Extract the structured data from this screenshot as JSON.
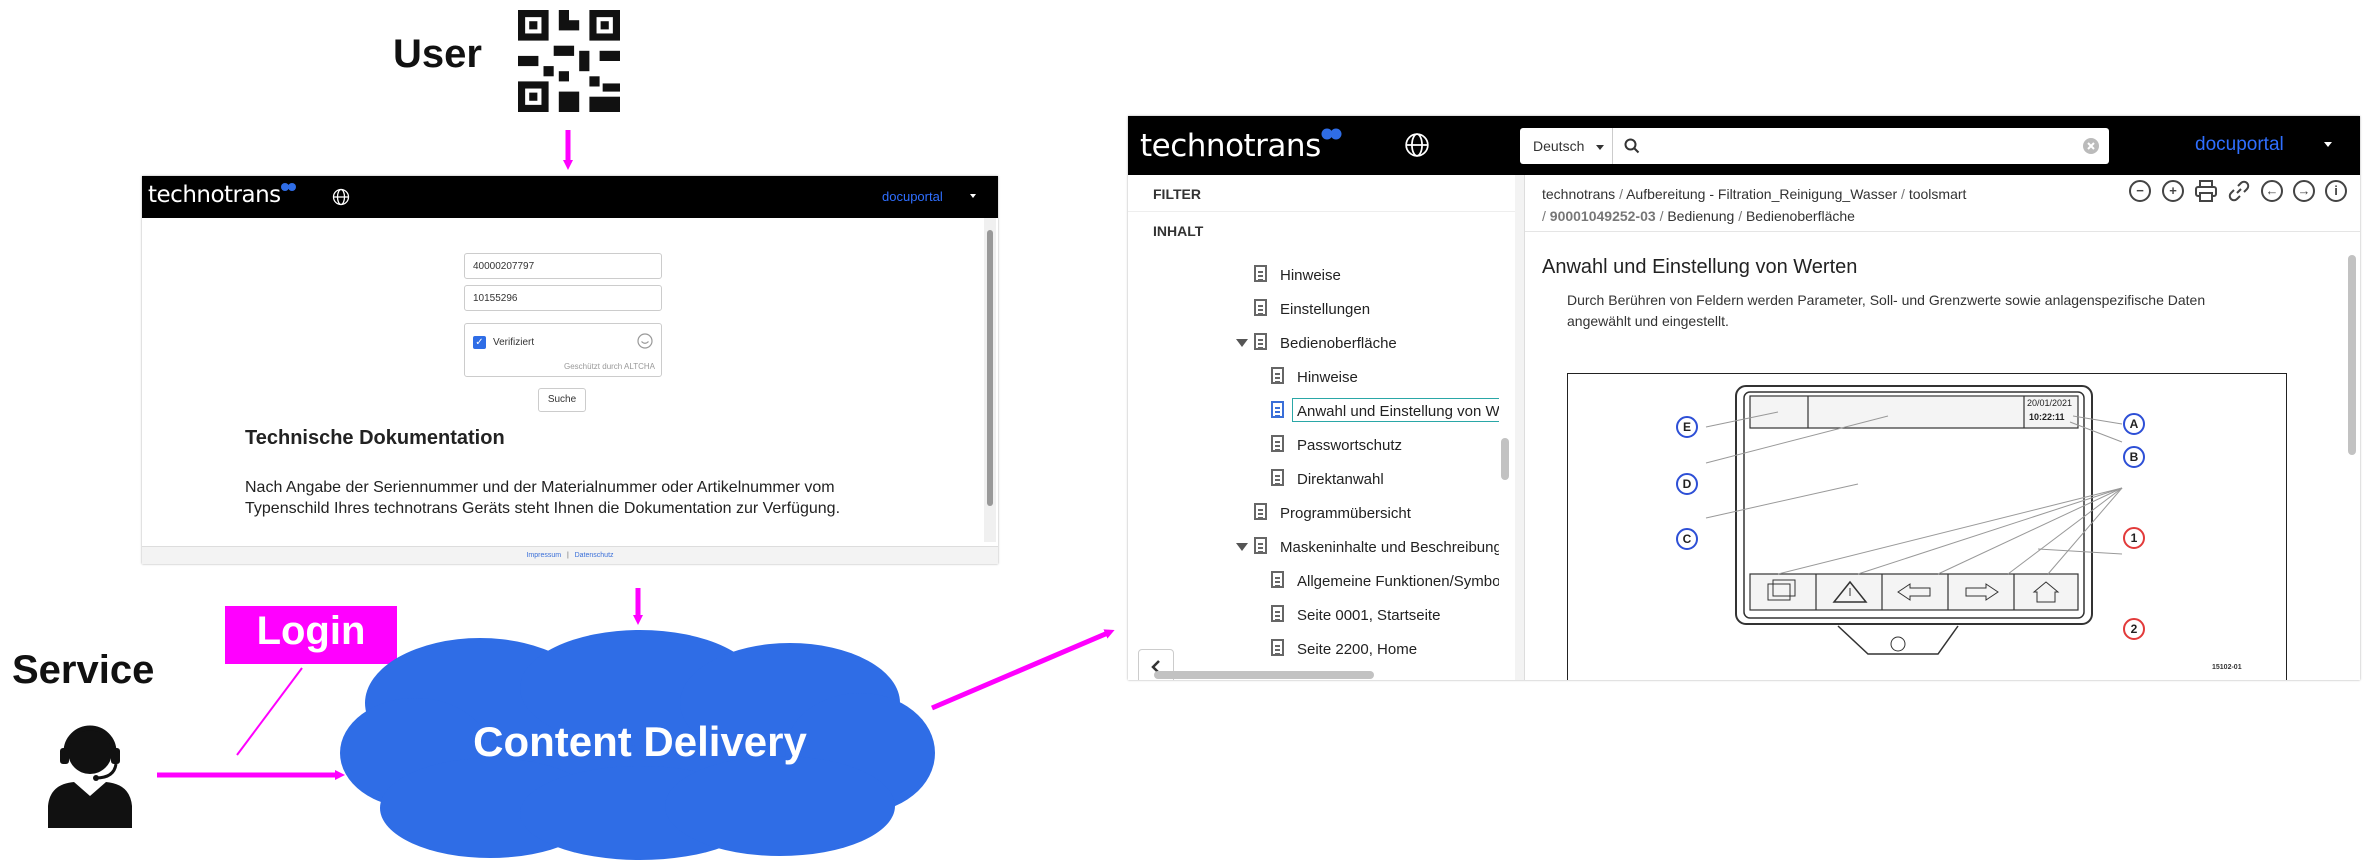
{
  "diagram": {
    "user_label": "User",
    "service_label": "Service",
    "login_label": "Login",
    "cloud_label": "Content Delivery",
    "colors": {
      "arrow": "#ff00ff",
      "cloud": "#2f6de6",
      "login_bg": "#ff00ff"
    }
  },
  "login_window": {
    "logo": "technotrans",
    "portal": "docuportal",
    "serial_value": "40000207797",
    "material_value": "10155296",
    "verified_label": "Verifiziert",
    "altcha_label": "Geschützt durch ALTCHA",
    "search_button": "Suche",
    "heading": "Technische Dokumentation",
    "body": "Nach Angabe der Seriennummer und der Materialnummer oder Artikelnummer vom Typenschild Ihres technotrans Geräts steht Ihnen die Dokumentation zur Verfügung.",
    "footer_impressum": "Impressum",
    "footer_sep": "|",
    "footer_datenschutz": "Datenschutz"
  },
  "portal_window": {
    "logo": "technotrans",
    "language": "Deutsch",
    "portal": "docuportal",
    "sidebar": {
      "filter": "FILTER",
      "inhalt": "INHALT",
      "items": [
        {
          "label": "Hinweise"
        },
        {
          "label": "Einstellungen"
        },
        {
          "label": "Bedienoberfläche"
        },
        {
          "label": "Hinweise"
        },
        {
          "label": "Anwahl und Einstellung von W"
        },
        {
          "label": "Passwortschutz"
        },
        {
          "label": "Direktanwahl"
        },
        {
          "label": "Programmübersicht"
        },
        {
          "label": "Maskeninhalte und Beschreibung"
        },
        {
          "label": "Allgemeine Funktionen/Symbo"
        },
        {
          "label": "Seite 0001, Startseite"
        },
        {
          "label": "Seite 2200, Home"
        }
      ]
    },
    "breadcrumb": {
      "c1": "technotrans",
      "c2": "Aufbereitung - Filtration_Reinigung_Wasser",
      "c3": "toolsmart",
      "c4": "90001049252-03",
      "c5": "Bedienung",
      "c6": "Bedienoberfläche",
      "sep": "/"
    },
    "content": {
      "title": "Anwahl und Einstellung von Werten",
      "text": "Durch Berühren von Feldern werden Parameter, Soll- und Grenzwerte sowie anlagenspezifische Daten angewählt und eingestellt."
    },
    "figure": {
      "date": "20/01/2021",
      "time": "10:22:11",
      "labels": [
        "A",
        "B",
        "C",
        "D",
        "E",
        "1",
        "2"
      ],
      "figure_id": "15102-01"
    }
  }
}
